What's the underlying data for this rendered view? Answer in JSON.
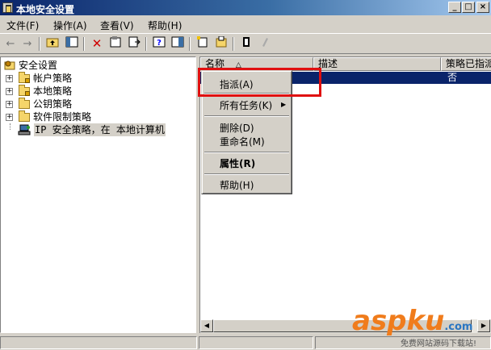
{
  "window": {
    "title": "本地安全设置"
  },
  "menubar": [
    "文件(F)",
    "操作(A)",
    "查看(V)",
    "帮助(H)"
  ],
  "toolbar": [
    "back-arrow",
    "forward-arrow",
    "up-folder",
    "show-tree",
    "delete",
    "properties",
    "export-list",
    "help",
    "show-console",
    "add-policy",
    "manage-filters",
    "assign",
    "unassign"
  ],
  "tree": {
    "root": "安全设置",
    "children": [
      "帐户策略",
      "本地策略",
      "公钥策略",
      "软件限制策略",
      "IP 安全策略，在 本地计算机"
    ]
  },
  "list": {
    "columns": [
      "名称",
      "描述",
      "策略已指派"
    ],
    "sort_indicator": "△",
    "row_assigned": "否"
  },
  "context_menu": {
    "items": [
      "指派(A)",
      "所有任务(K)",
      "删除(D)",
      "重命名(M)",
      "属性(R)",
      "帮助(H)"
    ]
  },
  "watermark": {
    "text": "aspku",
    "suffix": ".com",
    "subtext": "免费网站源码下载站!"
  },
  "colors": {
    "title_start": "#0a246a",
    "highlight_box": "#e01010",
    "wm_orange": "#f07c1c",
    "wm_blue": "#2a76c2"
  }
}
